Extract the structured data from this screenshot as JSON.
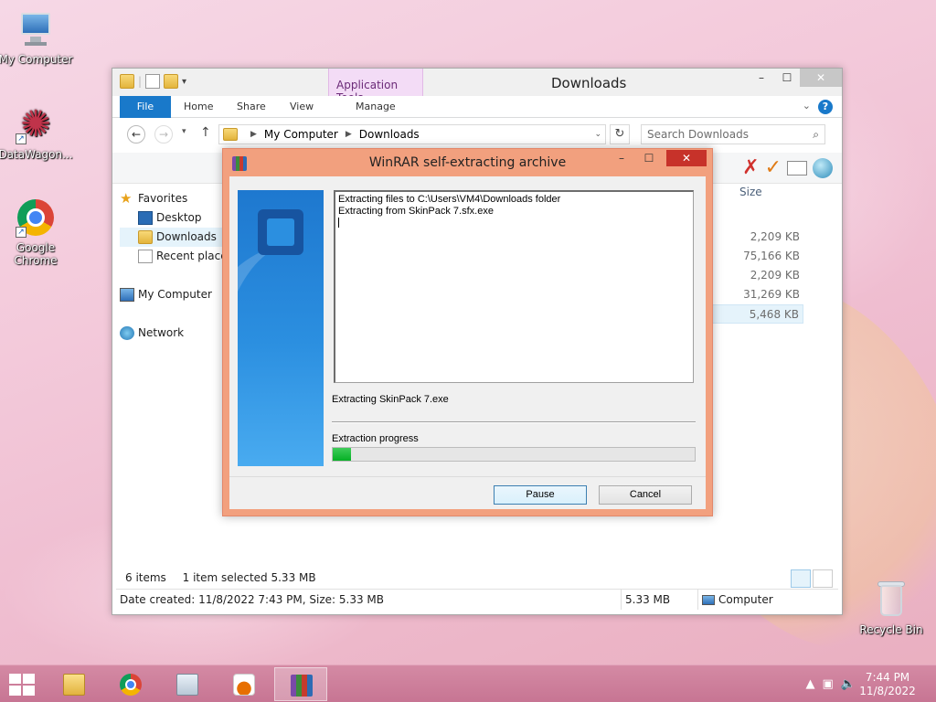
{
  "desktop": {
    "icons": [
      {
        "label": "My Computer"
      },
      {
        "label": "DataWagon..."
      },
      {
        "label": "Google Chrome"
      },
      {
        "label": "Recycle Bin"
      }
    ]
  },
  "explorer": {
    "title": "Downloads",
    "app_tools": "Application Tools",
    "tabs": [
      "File",
      "Home",
      "Share",
      "View",
      "Manage"
    ],
    "address": {
      "root": "My Computer",
      "folder": "Downloads"
    },
    "search_placeholder": "Search Downloads",
    "nav": {
      "favorites": "Favorites",
      "desktop": "Desktop",
      "downloads": "Downloads",
      "recent": "Recent places",
      "my_computer": "My Computer",
      "network": "Network"
    },
    "column_size": "Size",
    "sizes": [
      "2,209 KB",
      "75,166 KB",
      "2,209 KB",
      "31,269 KB",
      "5,468 KB"
    ],
    "status": {
      "items": "6 items",
      "selected": "1 item selected  5.33 MB"
    },
    "details": {
      "created": "Date created: 11/8/2022 7:43 PM, Size: 5.33 MB",
      "size": "5.33 MB",
      "location": "Computer"
    }
  },
  "winrar": {
    "title": "WinRAR self-extracting archive",
    "log_line1": "Extracting files to C:\\Users\\VM4\\Downloads folder",
    "log_line2": "Extracting from SkinPack 7.sfx.exe",
    "current": "Extracting SkinPack 7.exe",
    "progress_label": "Extraction progress",
    "progress_fraction": 0.05,
    "pause_label": "Pause",
    "cancel_label": "Cancel"
  },
  "taskbar": {
    "time": "7:44 PM",
    "date": "11/8/2022"
  }
}
